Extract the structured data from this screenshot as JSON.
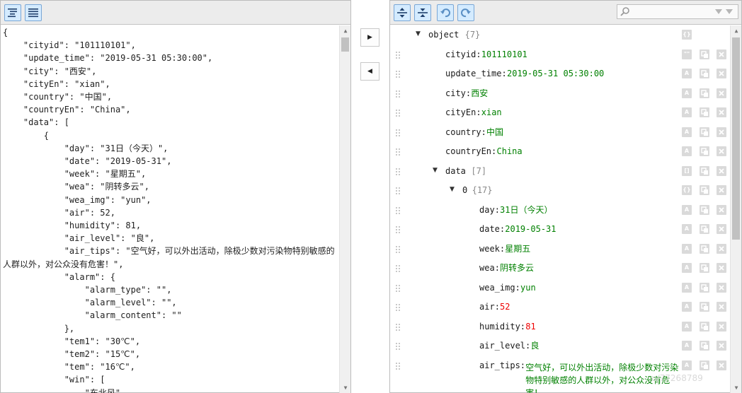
{
  "code_editor": {
    "lines": [
      "{",
      "    \"cityid\": \"101110101\",",
      "    \"update_time\": \"2019-05-31 05:30:00\",",
      "    \"city\": \"西安\",",
      "    \"cityEn\": \"xian\",",
      "    \"country\": \"中国\",",
      "    \"countryEn\": \"China\",",
      "    \"data\": [",
      "        {",
      "            \"day\": \"31日（今天）\",",
      "            \"date\": \"2019-05-31\",",
      "            \"week\": \"星期五\",",
      "            \"wea\": \"阴转多云\",",
      "            \"wea_img\": \"yun\",",
      "            \"air\": 52,",
      "            \"humidity\": 81,",
      "            \"air_level\": \"良\",",
      "            \"air_tips\": \"空气好，可以外出活动，除极少数对污染物特别敏感的人群以外，对公众没有危害！\",",
      "            \"alarm\": {",
      "                \"alarm_type\": \"\",",
      "                \"alarm_level\": \"\",",
      "                \"alarm_content\": \"\"",
      "            },",
      "            \"tem1\": \"30℃\",",
      "            \"tem2\": \"15℃\",",
      "            \"tem\": \"16℃\",",
      "            \"win\": [",
      "                \"东北风\","
    ]
  },
  "tree": {
    "search_placeholder": "",
    "colon": ":",
    "nodes": [
      {
        "key": "object",
        "meta": "{7}",
        "type": "object",
        "depth": 0,
        "expanded": true
      },
      {
        "key": "cityid",
        "value": "101110101",
        "type": "string",
        "depth": 1
      },
      {
        "key": "update_time",
        "value": "2019-05-31 05:30:00",
        "type": "string",
        "depth": 1
      },
      {
        "key": "city",
        "value": "西安",
        "type": "string",
        "depth": 1
      },
      {
        "key": "cityEn",
        "value": "xian",
        "type": "string",
        "depth": 1
      },
      {
        "key": "country",
        "value": "中国",
        "type": "string",
        "depth": 1
      },
      {
        "key": "countryEn",
        "value": "China",
        "type": "string",
        "depth": 1
      },
      {
        "key": "data",
        "meta": "[7]",
        "type": "array",
        "depth": 1,
        "expanded": true
      },
      {
        "key": "0",
        "meta": "{17}",
        "type": "object",
        "depth": 2,
        "expanded": true
      },
      {
        "key": "day",
        "value": "31日（今天）",
        "type": "string",
        "depth": 3
      },
      {
        "key": "date",
        "value": "2019-05-31",
        "type": "string",
        "depth": 3
      },
      {
        "key": "week",
        "value": "星期五",
        "type": "string",
        "depth": 3
      },
      {
        "key": "wea",
        "value": "阴转多云",
        "type": "string",
        "depth": 3
      },
      {
        "key": "wea_img",
        "value": "yun",
        "type": "string",
        "depth": 3
      },
      {
        "key": "air",
        "value": "52",
        "type": "number",
        "depth": 3
      },
      {
        "key": "humidity",
        "value": "81",
        "type": "number",
        "depth": 3
      },
      {
        "key": "air_level",
        "value": "良",
        "type": "string",
        "depth": 3
      },
      {
        "key": "air_tips",
        "value": "空气好，可以外出活动，除极少数对污染物特别敏感的人群以外，对公众没有危害！",
        "type": "string",
        "depth": 3
      }
    ]
  },
  "type_tags": {
    "object": "{}",
    "array": "[]",
    "string": "A",
    "number": "A",
    "first": "\"\""
  },
  "watermark": "u/77268789",
  "colors": {
    "string": "#008000",
    "number": "#ee0000",
    "toolbar_button": "#d4ebff",
    "toolbar_button_border": "#7aa7d6"
  },
  "icons": [
    "compact-icon",
    "format-icon",
    "copy-right-icon",
    "copy-left-icon",
    "expand-all-icon",
    "collapse-all-icon",
    "undo-icon",
    "redo-icon",
    "search-icon",
    "search-prev-icon",
    "search-next-icon",
    "drag-handle-icon",
    "duplicate-icon",
    "remove-icon"
  ]
}
